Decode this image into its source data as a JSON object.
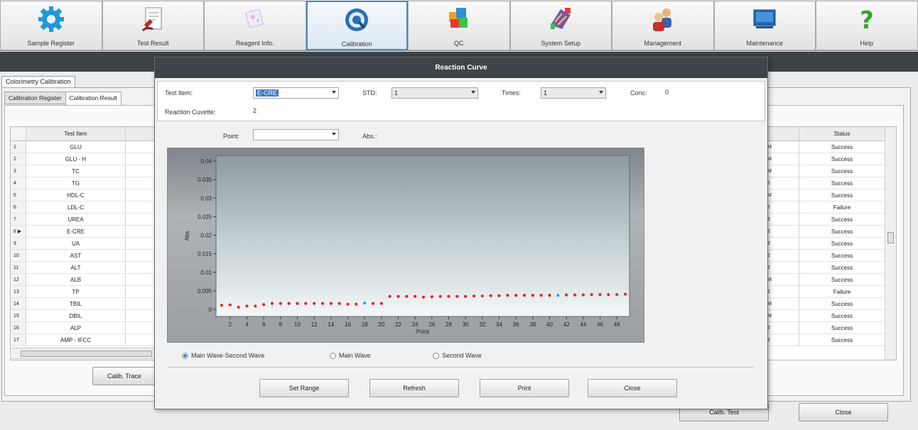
{
  "toolbar": {
    "buttons": [
      {
        "label": "Sample Register",
        "icon": "gear-icon"
      },
      {
        "label": "Test Result",
        "icon": "document-icon"
      },
      {
        "label": "Reagent Info.",
        "icon": "reagent-icon"
      },
      {
        "label": "Calibration",
        "icon": "calibration-icon"
      },
      {
        "label": "QC",
        "icon": "qc-cubes-icon"
      },
      {
        "label": "System Setup",
        "icon": "system-setup-icon"
      },
      {
        "label": "Management",
        "icon": "users-icon"
      },
      {
        "label": "Maintenance",
        "icon": "monitor-icon"
      },
      {
        "label": "Help",
        "icon": "help-icon"
      }
    ]
  },
  "background": {
    "outer_tab": "Colorimetry Calibration",
    "inner_tabs": [
      "Calibration Register",
      "Calibration Result"
    ],
    "left_table": {
      "header": "Test Item",
      "rows": [
        {
          "num": "1",
          "item": "GLU"
        },
        {
          "num": "2",
          "item": "GLU - H"
        },
        {
          "num": "3",
          "item": "TC"
        },
        {
          "num": "4",
          "item": "TG"
        },
        {
          "num": "5",
          "item": "HDL-C"
        },
        {
          "num": "6",
          "item": "LDL-C"
        },
        {
          "num": "7",
          "item": "UREA"
        },
        {
          "num": "8 ▶",
          "item": "E-CRE"
        },
        {
          "num": "9",
          "item": "UA"
        },
        {
          "num": "10",
          "item": "AST"
        },
        {
          "num": "11",
          "item": "ALT"
        },
        {
          "num": "12",
          "item": "ALB"
        },
        {
          "num": "13",
          "item": "TP"
        },
        {
          "num": "14",
          "item": "TBIL"
        },
        {
          "num": "15",
          "item": "DBIL"
        },
        {
          "num": "16",
          "item": "ALP"
        },
        {
          "num": "17",
          "item": "AMP - IFCC"
        }
      ]
    },
    "right_table": {
      "header": "Status",
      "rows": [
        {
          "mark": "M",
          "status": "Success"
        },
        {
          "mark": "M",
          "status": "Success"
        },
        {
          "mark": "M",
          "status": "Success"
        },
        {
          "mark": "J",
          "status": "Success"
        },
        {
          "mark": "M",
          "status": "Success"
        },
        {
          "mark": "J",
          "status": "Failure"
        },
        {
          "mark": "J",
          "status": "Success"
        },
        {
          "mark": "J",
          "status": "Success"
        },
        {
          "mark": "J",
          "status": "Success"
        },
        {
          "mark": "J",
          "status": "Success"
        },
        {
          "mark": "J",
          "status": "Success"
        },
        {
          "mark": "M",
          "status": "Success"
        },
        {
          "mark": "J",
          "status": "Failure"
        },
        {
          "mark": "M",
          "status": "Success"
        },
        {
          "mark": "M",
          "status": "Success"
        },
        {
          "mark": "J",
          "status": "Success"
        },
        {
          "mark": "J",
          "status": "Success"
        }
      ]
    },
    "calib_trace_btn": "Calib. Trace",
    "calib_test_btn": "Calib. Test",
    "close_btn": "Close"
  },
  "dialog": {
    "title": "Reaction Curve",
    "test_item_label": "Test Item:",
    "test_item_value": "E-CRE",
    "std_label": "STD:",
    "std_value": "1",
    "times_label": "Times:",
    "times_value": "1",
    "conc_label": "Conc:",
    "conc_value": "0",
    "cuvette_label": "Reaction Cuvette:",
    "cuvette_value": "2",
    "point_label": "Point:",
    "point_value": "",
    "abs_label": "Abs.:",
    "radios": [
      {
        "label": "Main Wave-Second Wave",
        "checked": true
      },
      {
        "label": "Main Wave",
        "checked": false
      },
      {
        "label": "Second Wave",
        "checked": false
      }
    ],
    "buttons": [
      "Set Range",
      "Refresh",
      "Print",
      "Close"
    ]
  },
  "chart_data": {
    "type": "scatter",
    "xlabel": "Point",
    "ylabel": "Abs",
    "xlim": [
      1,
      49
    ],
    "ylim": [
      0,
      0.04
    ],
    "xticks": [
      2,
      4,
      6,
      8,
      10,
      12,
      14,
      16,
      18,
      20,
      22,
      24,
      26,
      28,
      30,
      32,
      34,
      36,
      38,
      40,
      42,
      44,
      46,
      48
    ],
    "yticks": [
      0,
      0.005,
      0.01,
      0.015,
      0.02,
      0.025,
      0.03,
      0.035,
      0.04
    ],
    "ytick_labels": [
      "0",
      "0.005",
      "0.01",
      "0.015",
      "0.02",
      "0.025",
      "0.03",
      "0.035",
      "0.04"
    ],
    "point_color": "#e8242a",
    "highlight_color": "#33a7c9",
    "points": [
      {
        "x": 1,
        "y": 0.0011
      },
      {
        "x": 2,
        "y": 0.0012
      },
      {
        "x": 3,
        "y": 0.0006
      },
      {
        "x": 4,
        "y": 0.0009
      },
      {
        "x": 5,
        "y": 0.0009
      },
      {
        "x": 6,
        "y": 0.0013
      },
      {
        "x": 7,
        "y": 0.0016
      },
      {
        "x": 8,
        "y": 0.0016
      },
      {
        "x": 9,
        "y": 0.0016
      },
      {
        "x": 10,
        "y": 0.0016
      },
      {
        "x": 11,
        "y": 0.0016
      },
      {
        "x": 12,
        "y": 0.0016
      },
      {
        "x": 13,
        "y": 0.0016
      },
      {
        "x": 14,
        "y": 0.0016
      },
      {
        "x": 15,
        "y": 0.0016
      },
      {
        "x": 16,
        "y": 0.0014
      },
      {
        "x": 17,
        "y": 0.0014
      },
      {
        "x": 18,
        "y": 0.0017,
        "highlight": true
      },
      {
        "x": 19,
        "y": 0.0016
      },
      {
        "x": 20,
        "y": 0.0016
      },
      {
        "x": 21,
        "y": 0.0035
      },
      {
        "x": 22,
        "y": 0.0035
      },
      {
        "x": 23,
        "y": 0.0035
      },
      {
        "x": 24,
        "y": 0.0035
      },
      {
        "x": 25,
        "y": 0.0033
      },
      {
        "x": 26,
        "y": 0.0034
      },
      {
        "x": 27,
        "y": 0.0035
      },
      {
        "x": 28,
        "y": 0.0035
      },
      {
        "x": 29,
        "y": 0.0035
      },
      {
        "x": 30,
        "y": 0.0035
      },
      {
        "x": 31,
        "y": 0.0036
      },
      {
        "x": 32,
        "y": 0.0036
      },
      {
        "x": 33,
        "y": 0.0037
      },
      {
        "x": 34,
        "y": 0.0037
      },
      {
        "x": 35,
        "y": 0.0038
      },
      {
        "x": 36,
        "y": 0.0038
      },
      {
        "x": 37,
        "y": 0.0038
      },
      {
        "x": 38,
        "y": 0.0038
      },
      {
        "x": 39,
        "y": 0.0038
      },
      {
        "x": 40,
        "y": 0.0038
      },
      {
        "x": 41,
        "y": 0.0038,
        "highlight": true
      },
      {
        "x": 42,
        "y": 0.0039
      },
      {
        "x": 43,
        "y": 0.0039
      },
      {
        "x": 44,
        "y": 0.0039
      },
      {
        "x": 45,
        "y": 0.004
      },
      {
        "x": 46,
        "y": 0.004
      },
      {
        "x": 47,
        "y": 0.004
      },
      {
        "x": 48,
        "y": 0.004
      },
      {
        "x": 49,
        "y": 0.0041
      }
    ]
  }
}
